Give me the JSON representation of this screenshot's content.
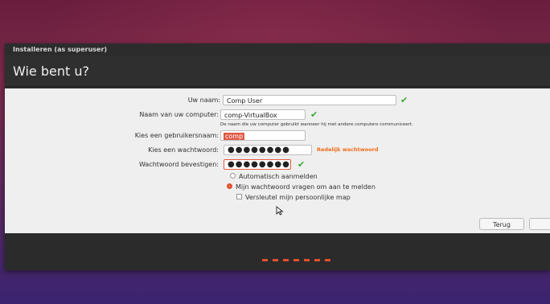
{
  "window": {
    "title": "Installeren (as superuser)",
    "heading": "Wie bent u?"
  },
  "form": {
    "name": {
      "label": "Uw naam:",
      "value": "Comp User"
    },
    "computer": {
      "label": "Naam van uw computer:",
      "value": "comp-VirtualBox",
      "hint": "De naam die uw computer gebruikt wanneer hij met andere computers communiceert."
    },
    "username": {
      "label": "Kies een gebruikersnaam:",
      "value": "comp"
    },
    "password": {
      "label": "Kies een wachtwoord:",
      "value": "●●●●●●●●",
      "strength": "Redelijk wachtwoord"
    },
    "confirm": {
      "label": "Wachtwoord bevestigen:",
      "value": "●●●●●●●●"
    },
    "options": {
      "auto_login": "Automatisch aanmelden",
      "ask_password": "Mijn wachtwoord vragen om aan te melden",
      "encrypt_home": "Versleutel mijn persoonlijke map"
    },
    "selected_option": "ask_password",
    "encrypt_checked": false
  },
  "buttons": {
    "back": "Terug"
  },
  "icons": {
    "valid": "checkmark-icon",
    "cursor": "mouse-pointer-icon"
  },
  "colors": {
    "accent": "#e2502c",
    "valid": "#3aa836",
    "strength": "#ef6c1a"
  },
  "progress": {
    "total_steps": 7
  }
}
